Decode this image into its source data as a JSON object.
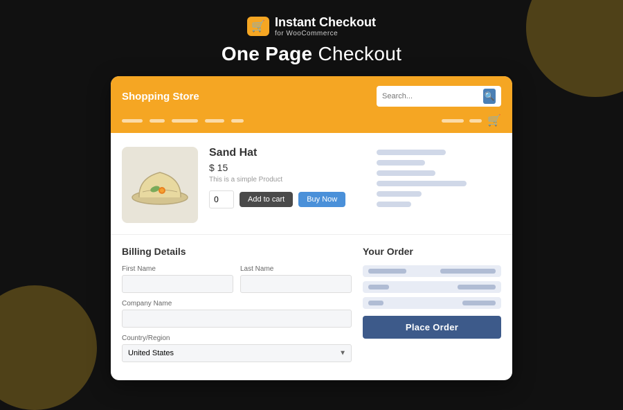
{
  "background": "#111",
  "logo": {
    "brand": "Instant Checkout",
    "sub": "for WooCommerce"
  },
  "page_title_bold": "One Page",
  "page_title_rest": " Checkout",
  "store": {
    "name": "Shopping Store",
    "search_placeholder": "Search..."
  },
  "nav": {
    "links": [
      30,
      22,
      38,
      28,
      18
    ],
    "right_placeholders": [
      32,
      18
    ],
    "cart_icon": "🛒"
  },
  "product": {
    "name": "Sand Hat",
    "price": "$ 15",
    "description": "This is a simple Product",
    "quantity": "0",
    "btn_add": "Add to cart",
    "btn_buy": "Buy Now",
    "right_lines": [
      100,
      70,
      85,
      65,
      50,
      60
    ]
  },
  "billing": {
    "title": "Billing Details",
    "fields": {
      "first_name": {
        "label": "First Name",
        "value": "",
        "placeholder": ""
      },
      "last_name": {
        "label": "Last Name",
        "value": "",
        "placeholder": ""
      },
      "company": {
        "label": "Company Name",
        "value": "",
        "placeholder": ""
      },
      "country": {
        "label": "Country/Region",
        "value": "United States"
      }
    }
  },
  "order": {
    "title": "Your Order",
    "rows": [
      {
        "left_w": 55,
        "right_w": 80
      },
      {
        "left_w": 30,
        "right_w": 55
      },
      {
        "left_w": 22,
        "right_w": 48
      }
    ],
    "btn_place": "Place Order"
  }
}
